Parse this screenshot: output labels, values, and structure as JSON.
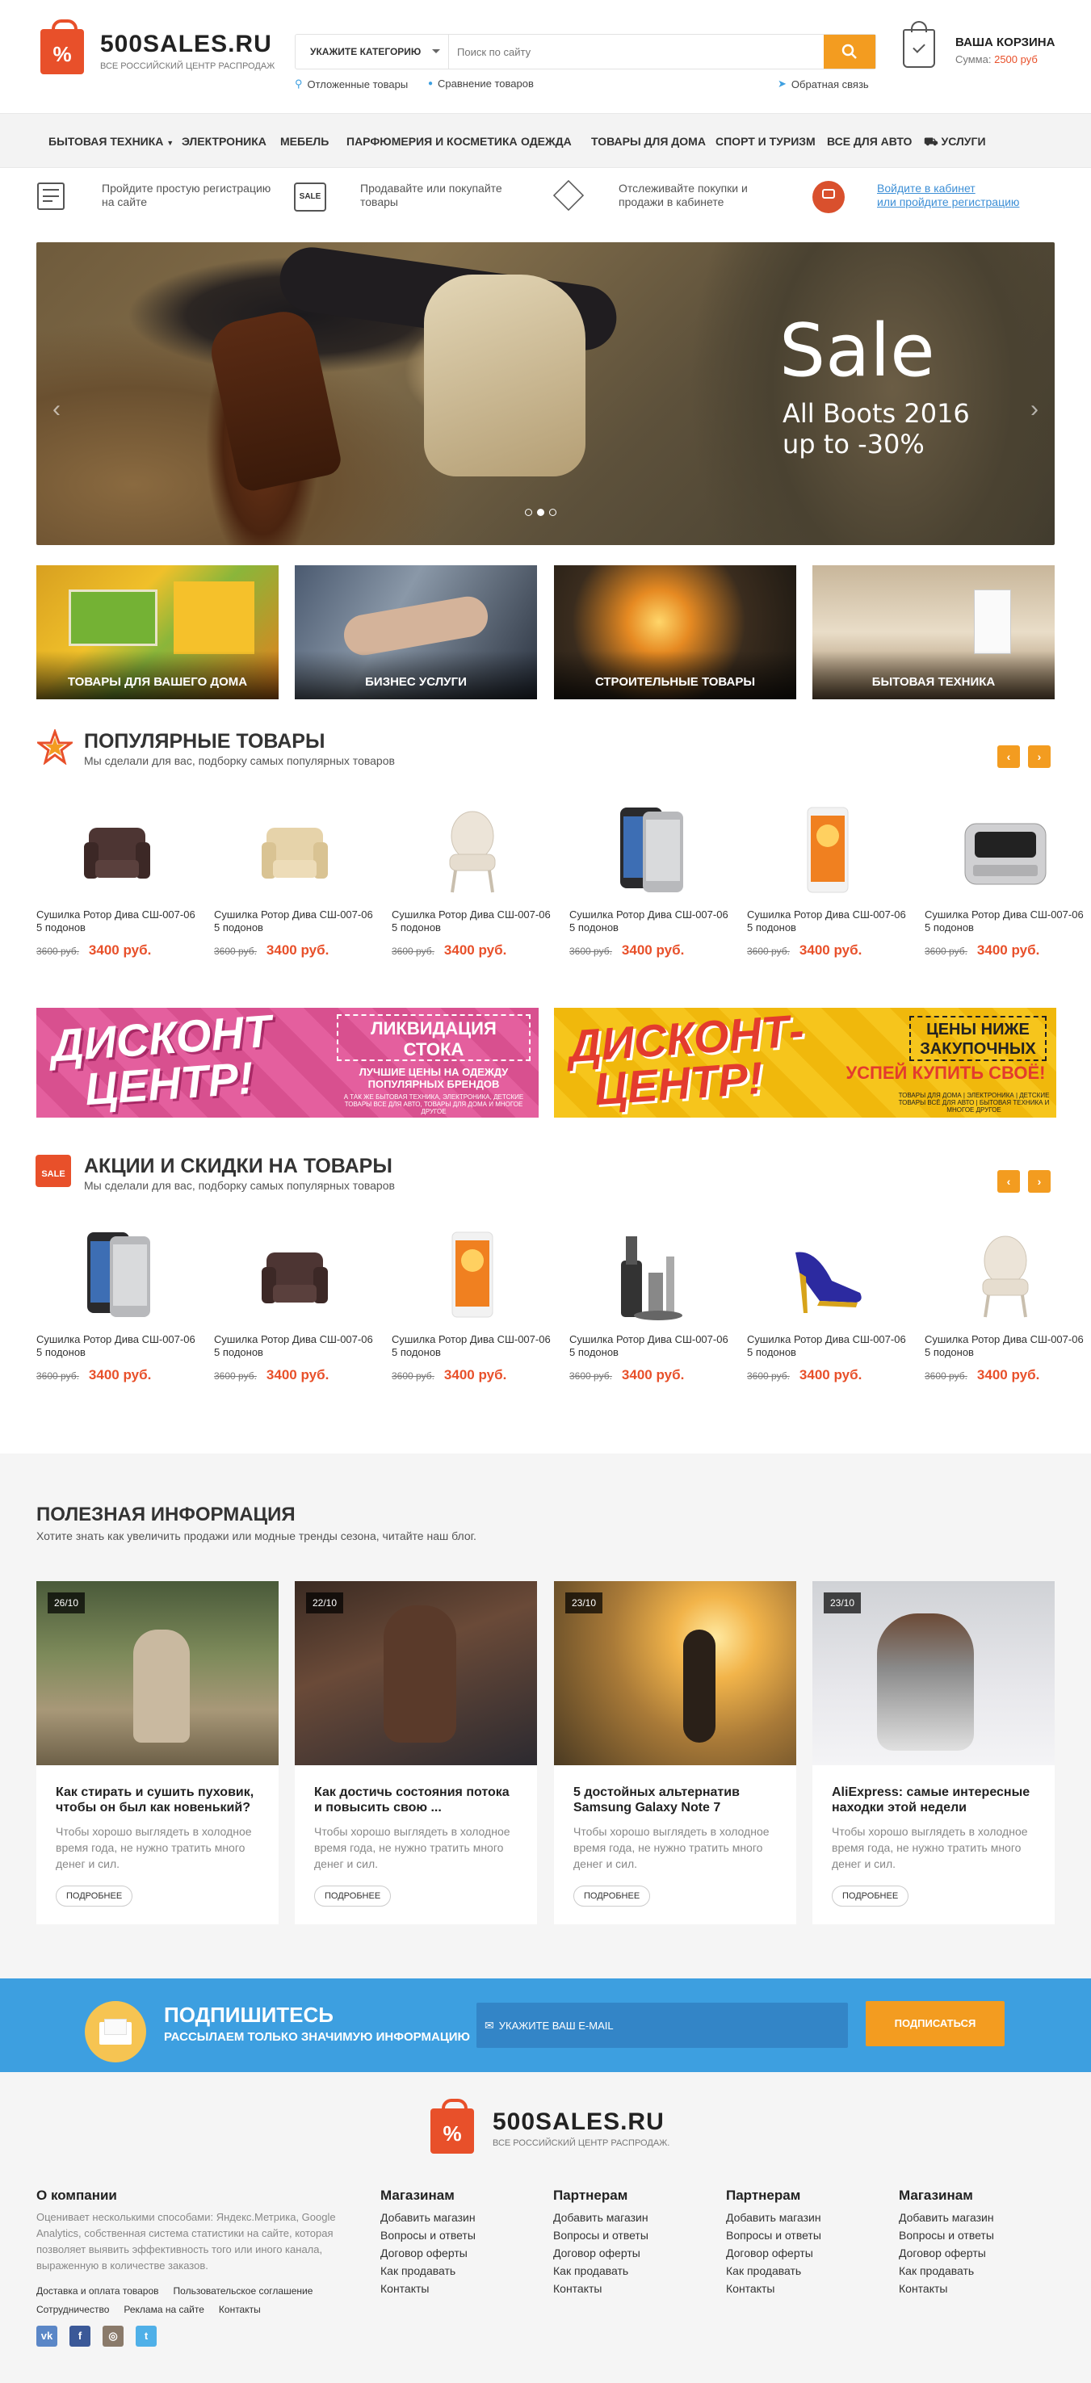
{
  "header": {
    "logo_name": "500SALES.RU",
    "logo_sub": "Все российский центр распродаж",
    "category_label": "Укажите категорию",
    "search_placeholder": "Поиск по сайту",
    "link_deferred": "Отложенные товары",
    "link_compare": "Сравнение товаров",
    "link_feedback": "Обратная связь",
    "cart_title": "Ваша корзина",
    "cart_sum_label": "Сумма:",
    "cart_sum_value": "2500 руб"
  },
  "nav": {
    "items": [
      "Бытовая техника",
      "Электроника",
      "Мебель",
      "Парфюмерия и косметика",
      "Одежда",
      "Товары для дома",
      "Спорт и туризм",
      "Все для авто",
      "Услуги"
    ]
  },
  "info": {
    "reg": "Пройдите простую регистрацию на сайте",
    "sell": "Продавайте или покупайте товары",
    "track": "Отслеживайте покупки и продажи в кабинете",
    "login_line1": "Войдите в кабинет",
    "login_line2": "или пройдите регистрацию",
    "sale_badge": "SALE"
  },
  "slider": {
    "title": "Sale",
    "line1": "All Boots 2016",
    "line2": "up to -30%"
  },
  "categories": [
    "Товары для вашего дома",
    "Бизнес услуги",
    "Строительные товары",
    "Бытовая техника"
  ],
  "popular": {
    "title": "Популярные товары",
    "subtitle": "Мы сделали для вас, подборку самых популярных товаров",
    "products": [
      {
        "name": "Сушилка Ротор Дива СШ-007-06 5 подонов",
        "old": "3600 руб.",
        "new": "3400 руб.",
        "icon": "armchair-dark"
      },
      {
        "name": "Сушилка Ротор Дива СШ-007-06 5 подонов",
        "old": "3600 руб.",
        "new": "3400 руб.",
        "icon": "armchair-beige"
      },
      {
        "name": "Сушилка Ротор Дива СШ-007-06 5 подонов",
        "old": "3600 руб.",
        "new": "3400 руб.",
        "icon": "chair-white"
      },
      {
        "name": "Сушилка Ротор Дива СШ-007-06 5 подонов",
        "old": "3600 руб.",
        "new": "3400 руб.",
        "icon": "phone-dark"
      },
      {
        "name": "Сушилка Ротор Дива СШ-007-06 5 подонов",
        "old": "3600 руб.",
        "new": "3400 руб.",
        "icon": "phone-white"
      },
      {
        "name": "Сушилка Ротор Дива СШ-007-06 5 подонов",
        "old": "3600 руб.",
        "new": "3400 руб.",
        "icon": "breadmaker"
      }
    ]
  },
  "banners": {
    "left_big1": "ДИСКОНТ",
    "left_big2": "ЦЕНТР!",
    "left_box": "ЛИКВИДАЦИЯ СТОКА",
    "left_sub": "ЛУЧШИЕ ЦЕНЫ НА ОДЕЖДУ ПОПУЛЯРНЫХ БРЕНДОВ",
    "left_small": "А ТАК ЖЕ БЫТОВАЯ ТЕХНИКА, ЭЛЕКТРОНИКА, ДЕТСКИЕ ТОВАРЫ ВСЕ ДЛЯ АВТО, ТОВАРЫ ДЛЯ ДОМА И МНОГОЕ ДРУГОЕ",
    "right_big1": "ДИСКОНТ-",
    "right_big2": "ЦЕНТР!",
    "right_box": "ЦЕНЫ НИЖЕ ЗАКУПОЧНЫХ",
    "right_sub": "УСПЕЙ КУПИТЬ СВОЁ!",
    "right_small": "ТОВАРЫ ДЛЯ ДОМА | ЭЛЕКТРОНИКА | ДЕТСКИЕ ТОВАРЫ ВСЁ ДЛЯ АВТО | БЫТОВАЯ ТЕХНИКА И МНОГОЕ ДРУГОЕ"
  },
  "sales": {
    "title": "Акции и скидки на товары",
    "subtitle": "Мы сделали для вас, подборку самых популярных товаров",
    "badge": "SALE",
    "products": [
      {
        "name": "Сушилка Ротор Дива СШ-007-06 5 подонов",
        "old": "3600 руб.",
        "new": "3400 руб.",
        "icon": "phone-dark"
      },
      {
        "name": "Сушилка Ротор Дива СШ-007-06 5 подонов",
        "old": "3600 руб.",
        "new": "3400 руб.",
        "icon": "armchair-dark"
      },
      {
        "name": "Сушилка Ротор Дива СШ-007-06 5 подонов",
        "old": "3600 руб.",
        "new": "3400 руб.",
        "icon": "phone-white"
      },
      {
        "name": "Сушилка Ротор Дива СШ-007-06 5 подонов",
        "old": "3600 руб.",
        "new": "3400 руб.",
        "icon": "blender"
      },
      {
        "name": "Сушилка Ротор Дива СШ-007-06 5 подонов",
        "old": "3600 руб.",
        "new": "3400 руб.",
        "icon": "shoe"
      },
      {
        "name": "Сушилка Ротор Дива СШ-007-06 5 подонов",
        "old": "3600 руб.",
        "new": "3400 руб.",
        "icon": "chair-white"
      }
    ]
  },
  "blog": {
    "title": "Полезная информация",
    "subtitle": "Хотите знать как увеличить продажи или модные тренды сезона, читайте наш блог.",
    "more": "Подробнее",
    "posts": [
      {
        "date": "26/10",
        "title": "Как стирать и сушить пуховик, чтобы он был как новенький?",
        "text": "Чтобы хорошо выглядеть в холодное время года, не нужно тратить много денег и сил."
      },
      {
        "date": "22/10",
        "title": "Как достичь состояния потока и повысить свою ...",
        "text": "Чтобы хорошо выглядеть в холодное время года, не нужно тратить много денег и сил."
      },
      {
        "date": "23/10",
        "title": "5 достойных альтернатив Samsung Galaxy Note 7",
        "text": "Чтобы хорошо выглядеть в холодное время года, не нужно тратить много денег и сил."
      },
      {
        "date": "23/10",
        "title": "AliExpress: самые интересные находки этой недели",
        "text": "Чтобы хорошо выглядеть в холодное время года, не нужно тратить много денег и сил."
      }
    ]
  },
  "subscribe": {
    "title": "Подпишитесь",
    "subtitle": "Рассылаем только значимую информацию",
    "placeholder": "Укажите ваш e-mail",
    "button": "Подписаться"
  },
  "footer": {
    "logo_name": "500SALES.RU",
    "logo_sub": "Все российский центр распродаж.",
    "about_title": "О компании",
    "about_text": "Оценивает несколькими способами: Яндекс.Метрика, Google Analytics, собственная система статистики на сайте, которая позволяет выявить эффективность того или иного канала, выраженную в количестве заказов.",
    "bottom_links": [
      "Доставка и оплата товаров",
      "Пользовательское соглашение",
      "Сотрудничество",
      "Реклама на сайте",
      "Контакты"
    ],
    "columns": [
      {
        "title": "Магазинам",
        "links": [
          "Добавить магазин",
          "Вопросы и ответы",
          "Договор оферты",
          "Как продавать",
          "Контакты"
        ]
      },
      {
        "title": "Партнерам",
        "links": [
          "Добавить магазин",
          "Вопросы и ответы",
          "Договор оферты",
          "Как продавать",
          "Контакты"
        ]
      },
      {
        "title": "Партнерам",
        "links": [
          "Добавить магазин",
          "Вопросы и ответы",
          "Договор оферты",
          "Как продавать",
          "Контакты"
        ]
      },
      {
        "title": "Магазинам",
        "links": [
          "Добавить магазин",
          "Вопросы и ответы",
          "Договор оферты",
          "Как продавать",
          "Контакты"
        ]
      }
    ],
    "socials": [
      "vk-icon",
      "facebook-icon",
      "instagram-icon",
      "twitter-icon"
    ]
  },
  "colors": {
    "accent": "#f39c20",
    "brand_red": "#e8502a",
    "subscribe_blue": "#3d9fe0",
    "link_blue": "#3d8fd6"
  }
}
